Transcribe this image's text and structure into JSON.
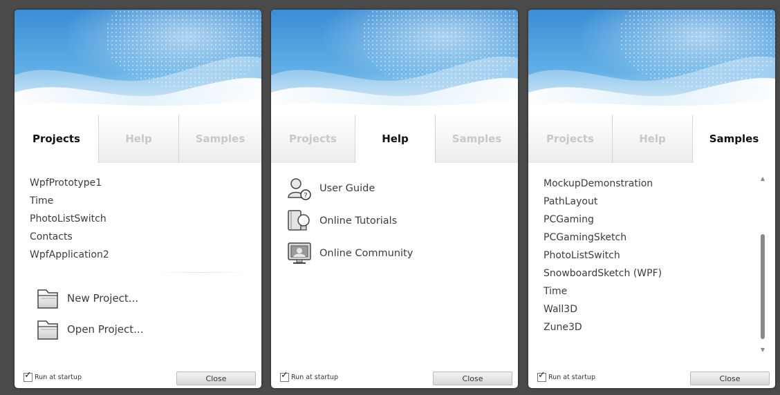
{
  "dialogs": [
    {
      "active_tab": "Projects",
      "tabs": [
        "Projects",
        "Help",
        "Samples"
      ],
      "recent_projects": [
        "WpfPrototype1",
        "Time",
        "PhotoListSwitch",
        "Contacts",
        "WpfApplication2"
      ],
      "actions": [
        "New Project...",
        "Open Project..."
      ],
      "run_at_startup_label": "Run at startup",
      "run_at_startup_checked": true,
      "close_label": "Close"
    },
    {
      "active_tab": "Help",
      "tabs": [
        "Projects",
        "Help",
        "Samples"
      ],
      "help_items": [
        "User Guide",
        "Online Tutorials",
        "Online Community"
      ],
      "run_at_startup_label": "Run at startup",
      "run_at_startup_checked": true,
      "close_label": "Close"
    },
    {
      "active_tab": "Samples",
      "tabs": [
        "Projects",
        "Help",
        "Samples"
      ],
      "samples": [
        "MockupDemonstration",
        "PathLayout",
        "PCGaming",
        "PCGamingSketch",
        "PhotoListSwitch",
        "SnowboardSketch (WPF)",
        "Time",
        "Wall3D",
        "Zune3D"
      ],
      "run_at_startup_label": "Run at startup",
      "run_at_startup_checked": true,
      "close_label": "Close"
    }
  ],
  "icons": {
    "new_project": "folder-icon",
    "open_project": "folder-icon",
    "user_guide": "user-help-icon",
    "online_tutorials": "tutorial-bulb-icon",
    "online_community": "community-monitor-icon",
    "scroll_up": "triangle-up-icon",
    "scroll_down": "triangle-down-icon"
  },
  "colors": {
    "banner_blue": "#3a95d8",
    "banner_light": "#cfe8f8",
    "background": "#4a4a4a",
    "active_tab_text": "#111111",
    "inactive_tab_text": "#c8c8c8"
  }
}
